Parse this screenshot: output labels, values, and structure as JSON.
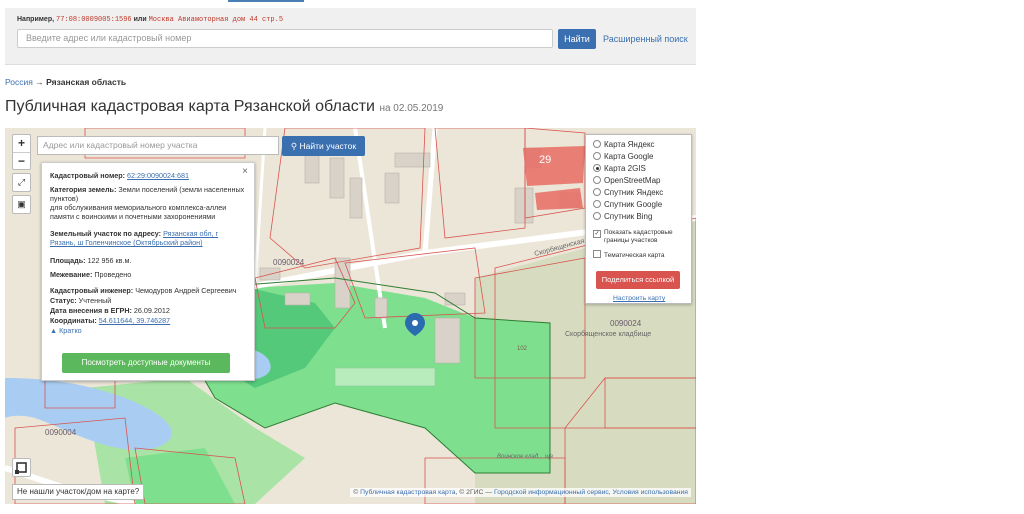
{
  "top_search": {
    "hint_prefix": "Например,",
    "hint_example1": "77:08:0009005:1596",
    "hint_or": "или",
    "hint_example2": "Москва Авиамоторная дом 44 стр.5",
    "input_placeholder": "Введите адрес или кадастровый номер",
    "find_label": "Найти",
    "advanced_label": "Расширенный поиск"
  },
  "breadcrumb": {
    "root": "Россия",
    "separator": "→",
    "current": "Рязанская область"
  },
  "title": {
    "text": "Публичная кадастровая карта Рязанской области",
    "date": "на 02.05.2019"
  },
  "map": {
    "search_placeholder": "Адрес или кадастровый номер участка",
    "find_plot_label": "Найти участок",
    "zoom_in": "+",
    "zoom_out": "−",
    "not_found_label": "Не нашли участок/дом на карте?",
    "attribution_prefix": "©",
    "attribution_link1": "Публичная кадастровая карта",
    "attribution_mid": ", © 2ГИС —",
    "attribution_link2": "Городской информационный сервис",
    "attribution_sep": ",",
    "attribution_link3": "Условия использования",
    "labels": {
      "block1": "0090024",
      "block2": "0090024",
      "block3": "0090004",
      "cemetery": "Скорбященское кладбище",
      "street": "Скорбященская",
      "military_cemetery": "Воинское клад... ще",
      "n29": "29",
      "n102": "102"
    }
  },
  "info": {
    "cad_num_label": "Кадастровый номер:",
    "cad_num_value": "62:29:0090024:681",
    "category_label": "Категория земель:",
    "category_value": "Земли поселений (земли населенных пунктов)",
    "purpose": "для обслуживания мемориального комплекса-аллеи памяти с воинскими и почетными захоронениями",
    "address_label": "Земельный участок по адресу:",
    "address_value": "Рязанская обл, г Рязань, ш Голенчинское (Октябрьский район)",
    "area_label": "Площадь:",
    "area_value": "122 956 кв.м.",
    "survey_label": "Межевание:",
    "survey_value": "Проведено",
    "engineer_label": "Кадастровый инженер:",
    "engineer_value": "Чемодуров Андрей Сергеевич",
    "status_label": "Статус:",
    "status_value": "Учтенный",
    "egrn_label": "Дата внесения в ЕГРН:",
    "egrn_value": "26.09.2012",
    "coords_label": "Координаты:",
    "coords_value": "54.611644, 39.746287",
    "collapse_label": "Кратко",
    "docs_button": "Посмотреть доступные документы",
    "close": "×"
  },
  "layers": {
    "options": [
      "Карта Яндекс",
      "Карта Google",
      "Карта 2GIS",
      "OpenStreetMap",
      "Спутник Яндекс",
      "Спутник Google",
      "Спутник Bing"
    ],
    "selected": "Карта 2GIS",
    "show_borders_label": "Показать кадастровые границы участков",
    "show_borders_checked": true,
    "thematic_label": "Тематическая карта",
    "thematic_checked": false,
    "share_label": "Поделиться ссылкой",
    "configure_label": "Настроить карту"
  }
}
